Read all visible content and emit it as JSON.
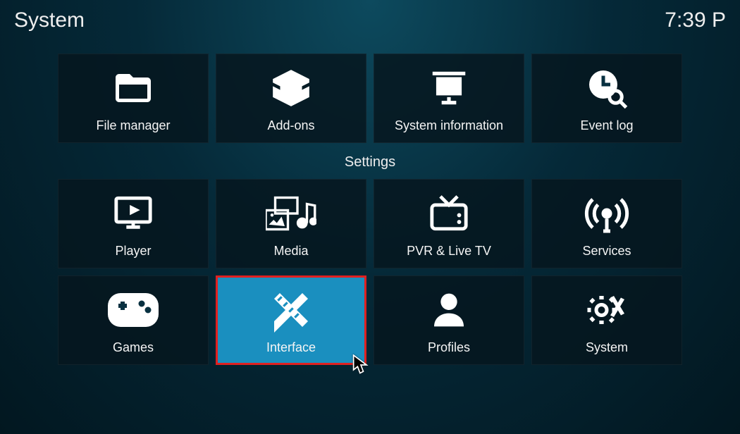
{
  "header": {
    "title": "System",
    "time": "7:39 P"
  },
  "section_label": "Settings",
  "tiles": {
    "row1": [
      {
        "label": "File manager"
      },
      {
        "label": "Add-ons"
      },
      {
        "label": "System information"
      },
      {
        "label": "Event log"
      }
    ],
    "row2": [
      {
        "label": "Player"
      },
      {
        "label": "Media"
      },
      {
        "label": "PVR & Live TV"
      },
      {
        "label": "Services"
      }
    ],
    "row3": [
      {
        "label": "Games"
      },
      {
        "label": "Interface"
      },
      {
        "label": "Profiles"
      },
      {
        "label": "System"
      }
    ]
  }
}
